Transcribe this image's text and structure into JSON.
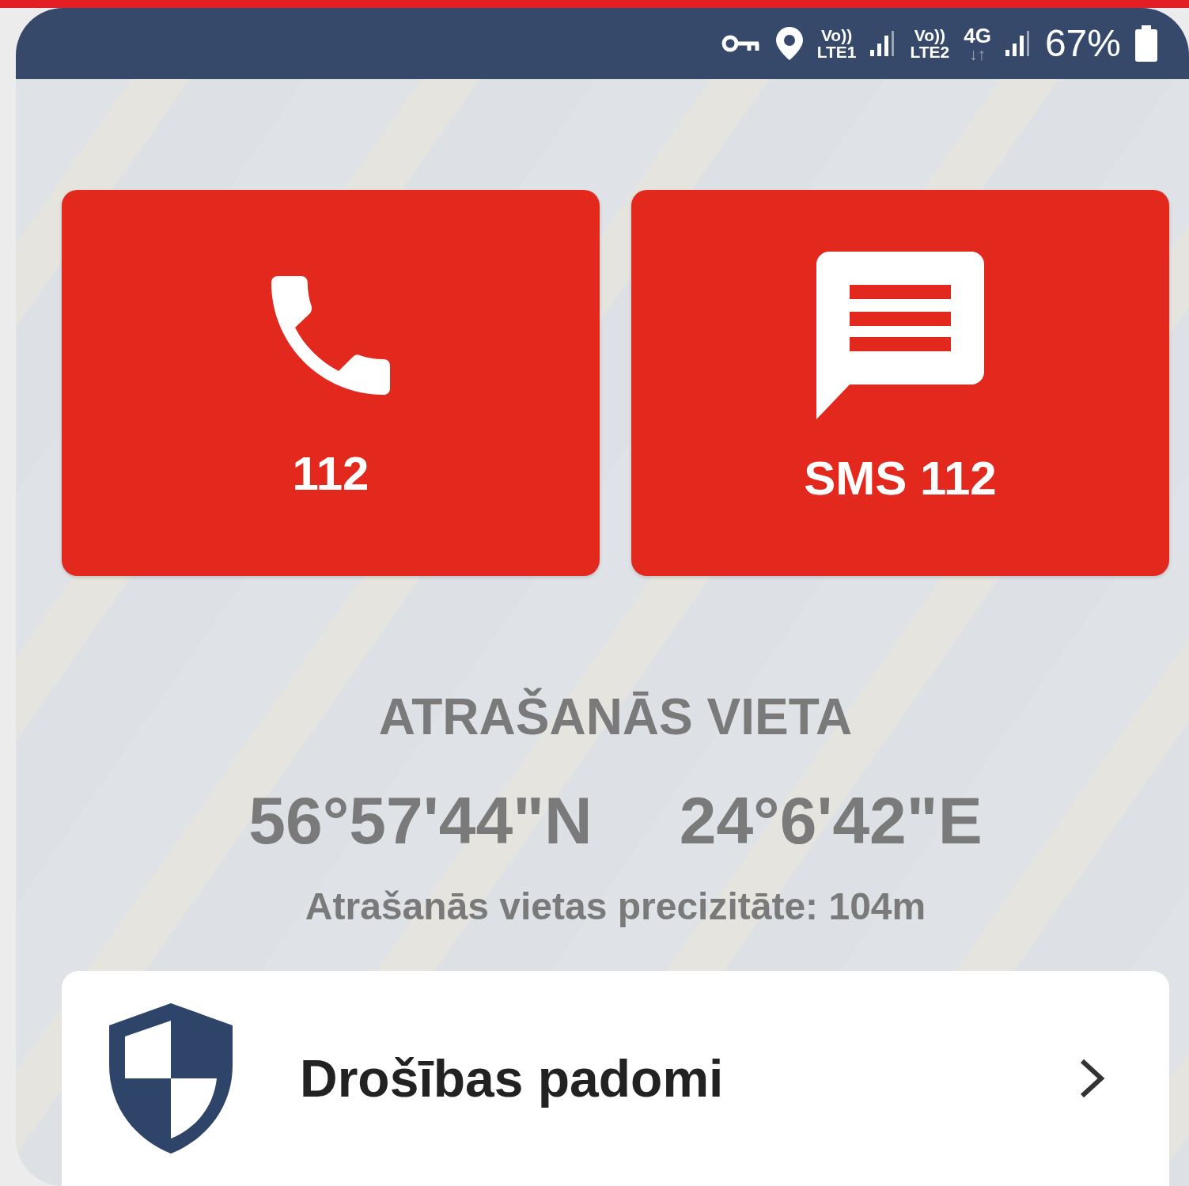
{
  "status_bar": {
    "indicators": [
      {
        "kind": "volte",
        "top": "Vo))",
        "bottom": "LTE1"
      },
      {
        "kind": "volte",
        "top": "Vo))",
        "bottom": "LTE2"
      },
      {
        "kind": "network",
        "top": "4G",
        "bottom": "↓↑"
      }
    ],
    "battery": "67%"
  },
  "actions": [
    {
      "kind": "call",
      "label": "112"
    },
    {
      "kind": "sms",
      "label": "SMS 112"
    }
  ],
  "location": {
    "heading": "ATRAŠANĀS VIETA",
    "latitude": "56°57'44\"N",
    "longitude": "24°6'42\"E",
    "accuracy": "Atrašanās vietas precizitāte: 104m"
  },
  "tips_card": {
    "label": "Drošības padomi"
  }
}
